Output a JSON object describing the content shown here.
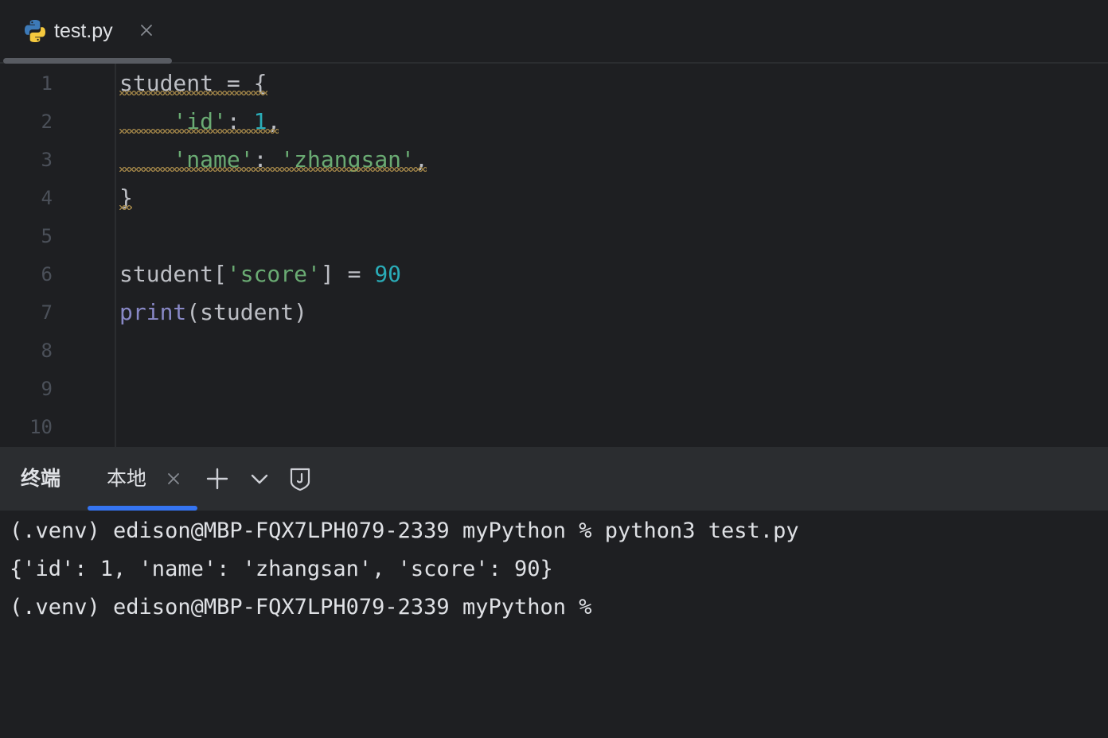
{
  "editor_tab": {
    "file_icon": "python-icon",
    "title": "test.py",
    "close_icon": "close-icon",
    "close_glyph": "×"
  },
  "editor": {
    "line_numbers": [
      "1",
      "2",
      "3",
      "4",
      "5",
      "6",
      "7",
      "8",
      "9",
      "10"
    ],
    "lines": [
      [
        {
          "t": "student = {",
          "c": "plain"
        }
      ],
      [
        {
          "t": "    ",
          "c": "plain"
        },
        {
          "t": "'id'",
          "c": "str"
        },
        {
          "t": ": ",
          "c": "plain"
        },
        {
          "t": "1",
          "c": "num"
        },
        {
          "t": ",",
          "c": "plain"
        }
      ],
      [
        {
          "t": "    ",
          "c": "plain"
        },
        {
          "t": "'name'",
          "c": "str"
        },
        {
          "t": ": ",
          "c": "plain"
        },
        {
          "t": "'zhangsan'",
          "c": "str"
        },
        {
          "t": ",",
          "c": "plain"
        }
      ],
      [
        {
          "t": "}",
          "c": "plain"
        }
      ],
      [],
      [
        {
          "t": "student[",
          "c": "plain"
        },
        {
          "t": "'score'",
          "c": "str"
        },
        {
          "t": "] = ",
          "c": "plain"
        },
        {
          "t": "90",
          "c": "num"
        }
      ],
      [
        {
          "t": "print",
          "c": "fn"
        },
        {
          "t": "(student)",
          "c": "plain"
        }
      ],
      [],
      [],
      []
    ],
    "colors": {
      "plain": "#bcbec4",
      "str": "#6aab73",
      "num": "#2aacb8",
      "fn": "#8888c6",
      "warning_squiggle": "#a88a4a"
    }
  },
  "terminal_panel": {
    "title": "终端",
    "tab_label": "本地",
    "tab_close_glyph": "×",
    "icons": [
      "plus-icon",
      "chevron-down-icon",
      "shield-icon"
    ],
    "accent": "#3574f0"
  },
  "terminal": {
    "lines": [
      "(.venv) edison@MBP-FQX7LPH079-2339 myPython % python3 test.py",
      "{'id': 1, 'name': 'zhangsan', 'score': 90}",
      "(.venv) edison@MBP-FQX7LPH079-2339 myPython % "
    ]
  }
}
